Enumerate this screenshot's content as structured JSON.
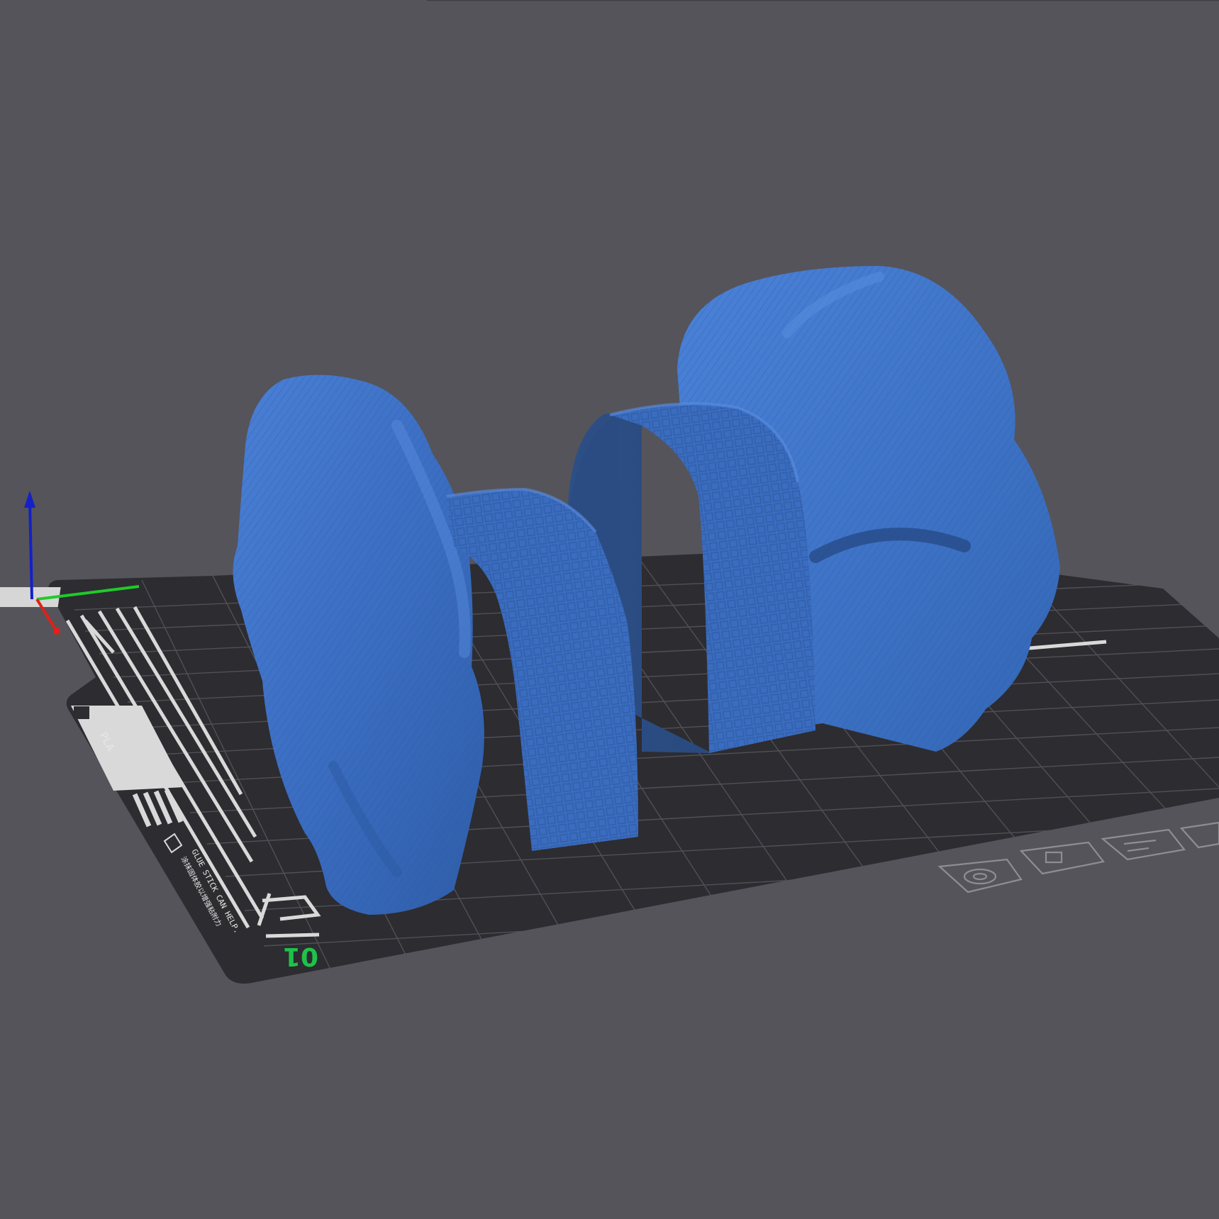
{
  "viewport": {
    "background_color": "#55545b"
  },
  "build_plate": {
    "plate_color": "#2d2c30",
    "grid_color": "#55545c",
    "marking_color": "#d9d9d9",
    "plate_number": "01",
    "plate_number_color": "#1ec24a",
    "material_label": "PLA",
    "sticker_text": "GLUE STICK CAN HELP.",
    "sticker_text_cn": "涂抹固体胶以增强粘附力",
    "accessory_icons": [
      "nut-icon",
      "card-icon",
      "layers-icon",
      "box-icon"
    ]
  },
  "axes_gizmo": {
    "x_axis_color": "#e0201a",
    "y_axis_color": "#1ecb2a",
    "z_axis_color": "#1420c8"
  },
  "models": [
    {
      "name": "left-organic-model",
      "color": "#3f72c6"
    },
    {
      "name": "left-textured-arch",
      "color": "#3a6cbf"
    },
    {
      "name": "right-organic-model",
      "color": "#3f72c6"
    },
    {
      "name": "right-textured-arch",
      "color": "#3a6cbf"
    }
  ]
}
